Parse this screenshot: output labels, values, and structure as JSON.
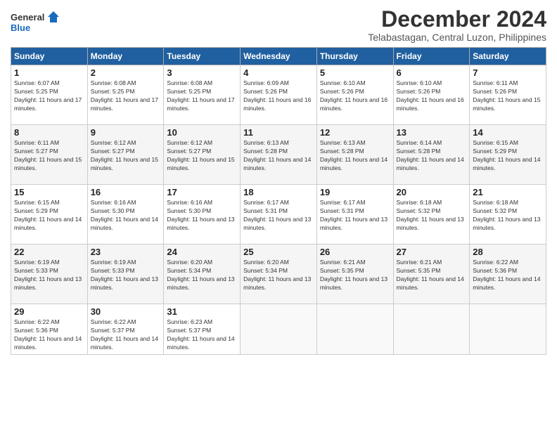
{
  "logo": {
    "line1": "General",
    "line2": "Blue"
  },
  "title": "December 2024",
  "subtitle": "Telabastagan, Central Luzon, Philippines",
  "weekdays": [
    "Sunday",
    "Monday",
    "Tuesday",
    "Wednesday",
    "Thursday",
    "Friday",
    "Saturday"
  ],
  "weeks": [
    [
      {
        "day": "1",
        "sunrise": "6:07 AM",
        "sunset": "5:25 PM",
        "daylight": "11 hours and 17 minutes."
      },
      {
        "day": "2",
        "sunrise": "6:08 AM",
        "sunset": "5:25 PM",
        "daylight": "11 hours and 17 minutes."
      },
      {
        "day": "3",
        "sunrise": "6:08 AM",
        "sunset": "5:25 PM",
        "daylight": "11 hours and 17 minutes."
      },
      {
        "day": "4",
        "sunrise": "6:09 AM",
        "sunset": "5:26 PM",
        "daylight": "11 hours and 16 minutes."
      },
      {
        "day": "5",
        "sunrise": "6:10 AM",
        "sunset": "5:26 PM",
        "daylight": "11 hours and 16 minutes."
      },
      {
        "day": "6",
        "sunrise": "6:10 AM",
        "sunset": "5:26 PM",
        "daylight": "11 hours and 16 minutes."
      },
      {
        "day": "7",
        "sunrise": "6:11 AM",
        "sunset": "5:26 PM",
        "daylight": "11 hours and 15 minutes."
      }
    ],
    [
      {
        "day": "8",
        "sunrise": "6:11 AM",
        "sunset": "5:27 PM",
        "daylight": "11 hours and 15 minutes."
      },
      {
        "day": "9",
        "sunrise": "6:12 AM",
        "sunset": "5:27 PM",
        "daylight": "11 hours and 15 minutes."
      },
      {
        "day": "10",
        "sunrise": "6:12 AM",
        "sunset": "5:27 PM",
        "daylight": "11 hours and 15 minutes."
      },
      {
        "day": "11",
        "sunrise": "6:13 AM",
        "sunset": "5:28 PM",
        "daylight": "11 hours and 14 minutes."
      },
      {
        "day": "12",
        "sunrise": "6:13 AM",
        "sunset": "5:28 PM",
        "daylight": "11 hours and 14 minutes."
      },
      {
        "day": "13",
        "sunrise": "6:14 AM",
        "sunset": "5:28 PM",
        "daylight": "11 hours and 14 minutes."
      },
      {
        "day": "14",
        "sunrise": "6:15 AM",
        "sunset": "5:29 PM",
        "daylight": "11 hours and 14 minutes."
      }
    ],
    [
      {
        "day": "15",
        "sunrise": "6:15 AM",
        "sunset": "5:29 PM",
        "daylight": "11 hours and 14 minutes."
      },
      {
        "day": "16",
        "sunrise": "6:16 AM",
        "sunset": "5:30 PM",
        "daylight": "11 hours and 14 minutes."
      },
      {
        "day": "17",
        "sunrise": "6:16 AM",
        "sunset": "5:30 PM",
        "daylight": "11 hours and 13 minutes."
      },
      {
        "day": "18",
        "sunrise": "6:17 AM",
        "sunset": "5:31 PM",
        "daylight": "11 hours and 13 minutes."
      },
      {
        "day": "19",
        "sunrise": "6:17 AM",
        "sunset": "5:31 PM",
        "daylight": "11 hours and 13 minutes."
      },
      {
        "day": "20",
        "sunrise": "6:18 AM",
        "sunset": "5:32 PM",
        "daylight": "11 hours and 13 minutes."
      },
      {
        "day": "21",
        "sunrise": "6:18 AM",
        "sunset": "5:32 PM",
        "daylight": "11 hours and 13 minutes."
      }
    ],
    [
      {
        "day": "22",
        "sunrise": "6:19 AM",
        "sunset": "5:33 PM",
        "daylight": "11 hours and 13 minutes."
      },
      {
        "day": "23",
        "sunrise": "6:19 AM",
        "sunset": "5:33 PM",
        "daylight": "11 hours and 13 minutes."
      },
      {
        "day": "24",
        "sunrise": "6:20 AM",
        "sunset": "5:34 PM",
        "daylight": "11 hours and 13 minutes."
      },
      {
        "day": "25",
        "sunrise": "6:20 AM",
        "sunset": "5:34 PM",
        "daylight": "11 hours and 13 minutes."
      },
      {
        "day": "26",
        "sunrise": "6:21 AM",
        "sunset": "5:35 PM",
        "daylight": "11 hours and 13 minutes."
      },
      {
        "day": "27",
        "sunrise": "6:21 AM",
        "sunset": "5:35 PM",
        "daylight": "11 hours and 14 minutes."
      },
      {
        "day": "28",
        "sunrise": "6:22 AM",
        "sunset": "5:36 PM",
        "daylight": "11 hours and 14 minutes."
      }
    ],
    [
      {
        "day": "29",
        "sunrise": "6:22 AM",
        "sunset": "5:36 PM",
        "daylight": "11 hours and 14 minutes."
      },
      {
        "day": "30",
        "sunrise": "6:22 AM",
        "sunset": "5:37 PM",
        "daylight": "11 hours and 14 minutes."
      },
      {
        "day": "31",
        "sunrise": "6:23 AM",
        "sunset": "5:37 PM",
        "daylight": "11 hours and 14 minutes."
      },
      null,
      null,
      null,
      null
    ]
  ]
}
